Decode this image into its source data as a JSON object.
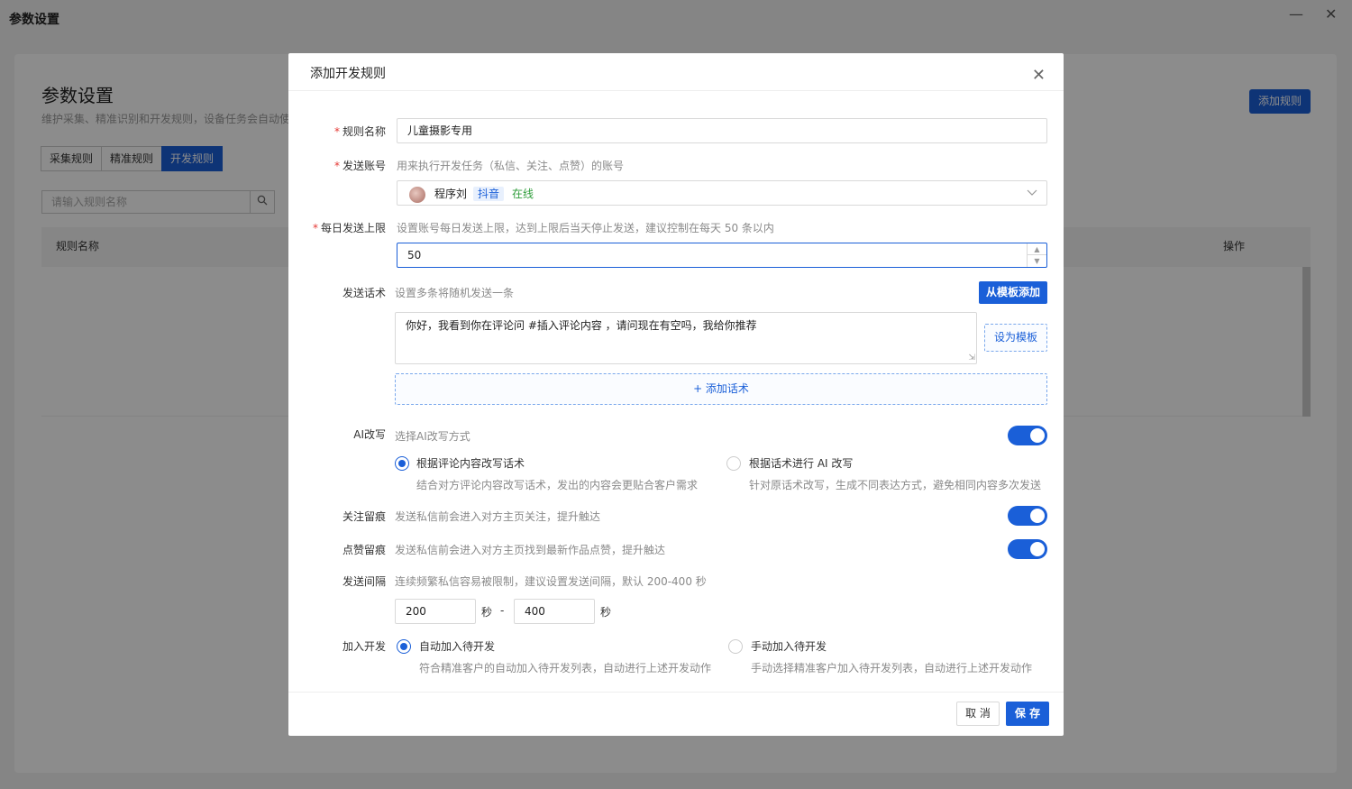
{
  "window": {
    "title": "参数设置",
    "minimize_icon": "minimize-icon",
    "close_icon": "close-icon"
  },
  "background": {
    "page_title": "参数设置",
    "subtitle": "维护采集、精准识别和开发规则，设备任务会自动使",
    "add_rule_button": "添加规则",
    "tabs": [
      "采集规则",
      "精准规则",
      "开发规则"
    ],
    "active_tab": "开发规则",
    "search_placeholder": "请输入规则名称",
    "table_headers": [
      "规则名称",
      "操作"
    ]
  },
  "dialog": {
    "title": "添加开发规则",
    "fields": {
      "rule_name": {
        "label": "规则名称",
        "value": "儿童摄影专用",
        "required": true
      },
      "send_account": {
        "label": "发送账号",
        "hint": "用来执行开发任务（私信、关注、点赞）的账号",
        "required": true,
        "account_name": "程序刘",
        "platform": "抖音",
        "status": "在线"
      },
      "daily_limit": {
        "label": "每日发送上限",
        "hint": "设置账号每日发送上限，达到上限后当天停止发送，建议控制在每天 50 条以内",
        "required": true,
        "value": "50"
      },
      "scripts": {
        "label": "发送话术",
        "hint": "设置多条将随机发送一条",
        "from_template_button": "从模板添加",
        "script_text": "你好，我看到你在评论问 #插入评论内容 ，请问现在有空吗，我给你推荐",
        "set_template_button": "设为模板",
        "add_script_button": "+ 添加话术"
      },
      "ai_rewrite": {
        "label": "AI改写",
        "hint": "选择AI改写方式",
        "enabled": true,
        "options": [
          {
            "title": "根据评论内容改写话术",
            "desc": "结合对方评论内容改写话术，发出的内容会更贴合客户需求",
            "selected": true
          },
          {
            "title": "根据话术进行 AI 改写",
            "desc": "针对原话术改写，生成不同表达方式，避免相同内容多次发送",
            "selected": false
          }
        ]
      },
      "follow_trace": {
        "label": "关注留痕",
        "hint": "发送私信前会进入对方主页关注，提升触达",
        "enabled": true
      },
      "like_trace": {
        "label": "点赞留痕",
        "hint": "发送私信前会进入对方主页找到最新作品点赞，提升触达",
        "enabled": true
      },
      "interval": {
        "label": "发送间隔",
        "hint": "连续频繁私信容易被限制，建议设置发送间隔，默认 200-400 秒",
        "min": "200",
        "max": "400",
        "unit": "秒",
        "separator": "-"
      },
      "join_dev": {
        "label": "加入开发",
        "options": [
          {
            "title": "自动加入待开发",
            "desc": "符合精准客户的自动加入待开发列表，自动进行上述开发动作",
            "selected": true
          },
          {
            "title": "手动加入待开发",
            "desc": "手动选择精准客户加入待开发列表，自动进行上述开发动作",
            "selected": false
          }
        ]
      }
    },
    "cancel_button": "取 消",
    "save_button": "保 存"
  },
  "colors": {
    "primary": "#1a5fd8",
    "required": "#e53935",
    "online": "#2e9d3a"
  }
}
